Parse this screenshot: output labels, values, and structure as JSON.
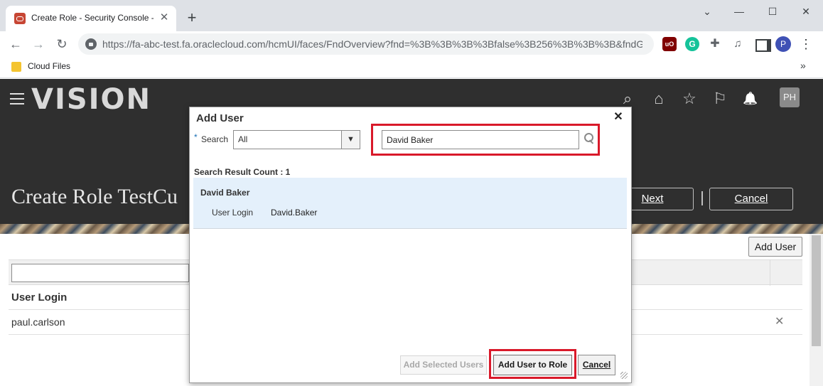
{
  "browser": {
    "tab_title": "Create Role - Security Console - Oracle",
    "tab_close": "✕",
    "new_tab": "+",
    "window_controls": {
      "minimize": "⌄",
      "min": "—",
      "max": "☐",
      "close": "✕"
    },
    "url": "https://fa-abc-test.fa.oraclecloud.com/hcmUI/faces/FndOverview?fnd=%3B%3B%3B%3Bfalse%3B256%3B%3B%3B&fndGl...",
    "profile_initial": "P",
    "ublock_label": "uO",
    "grammarly_label": "G",
    "bookmark_folder_label": "Cloud Files",
    "bookmarks_more": "»",
    "nav": {
      "back": "←",
      "forward": "→",
      "reload": "↻"
    }
  },
  "app": {
    "logo": "VISION",
    "user_initials": "PH",
    "page_title": "Create Role TestCu",
    "next_label": "Next",
    "cancel_label": "Cancel",
    "add_user_label": "Add User",
    "table": {
      "column_header": "User Login",
      "rows": [
        {
          "login": "paul.carlson",
          "remove": "✕"
        }
      ]
    },
    "icons": {
      "search": "⌕",
      "home": "⌂",
      "favorites": "☆",
      "flag": "⚐",
      "bell": "🔔"
    }
  },
  "dialog": {
    "title": "Add User",
    "close": "✕",
    "required_marker": "*",
    "search_label": "Search",
    "search_scope_value": "All",
    "search_scope_arrow": "▼",
    "search_value": "David Baker",
    "result_count": "Search Result Count : 1",
    "result": {
      "name": "David Baker",
      "login_label": "User Login",
      "login_value": "David.Baker"
    },
    "buttons": {
      "add_selected": "Add Selected Users",
      "add_to_role": "Add User to Role",
      "cancel": "Cancel"
    }
  },
  "colors": {
    "highlight_red": "#d9192a",
    "header_dark": "#2f2f2f",
    "result_bg": "#e4f0fb"
  }
}
